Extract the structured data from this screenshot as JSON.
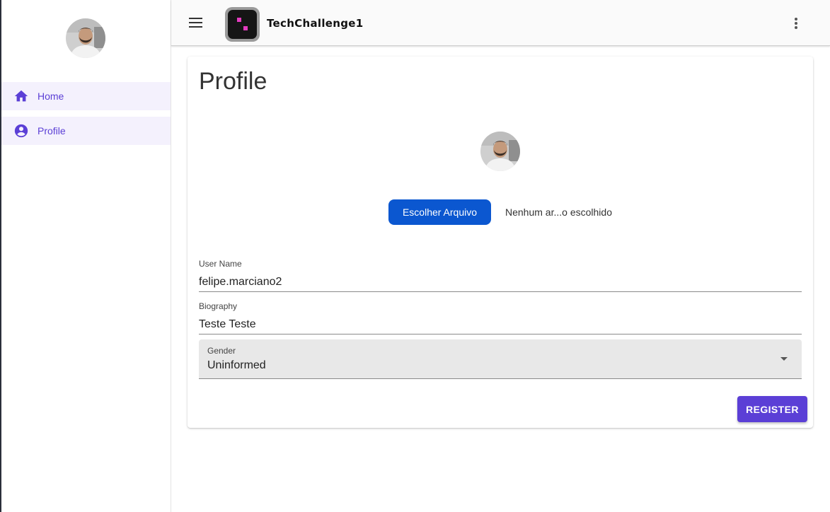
{
  "sidebar": {
    "avatar_icon": "user-avatar-photo",
    "items": [
      {
        "label": "Home",
        "icon": "home-icon"
      },
      {
        "label": "Profile",
        "icon": "account-circle-icon"
      }
    ]
  },
  "header": {
    "app_title": "TechChallenge1",
    "menu_icon": "menu-icon",
    "more_icon": "more-vert-icon"
  },
  "main": {
    "page_title": "Profile",
    "avatar_icon": "user-avatar-photo",
    "file_picker": {
      "button_label": "Escolher Arquivo",
      "status": "Nenhum ar...o escolhido"
    },
    "form": {
      "username": {
        "label": "User Name",
        "value": "felipe.marciano2"
      },
      "biography": {
        "label": "Biography",
        "value": "Teste Teste"
      },
      "gender": {
        "label": "Gender",
        "value": "Uninformed"
      },
      "register_label": "REGISTER"
    }
  },
  "colors": {
    "accent": "#5b3fd6",
    "nav_active_bg": "#f4f1fd",
    "file_button": "#0b57d0",
    "logo_dot": "#e43cc0"
  }
}
